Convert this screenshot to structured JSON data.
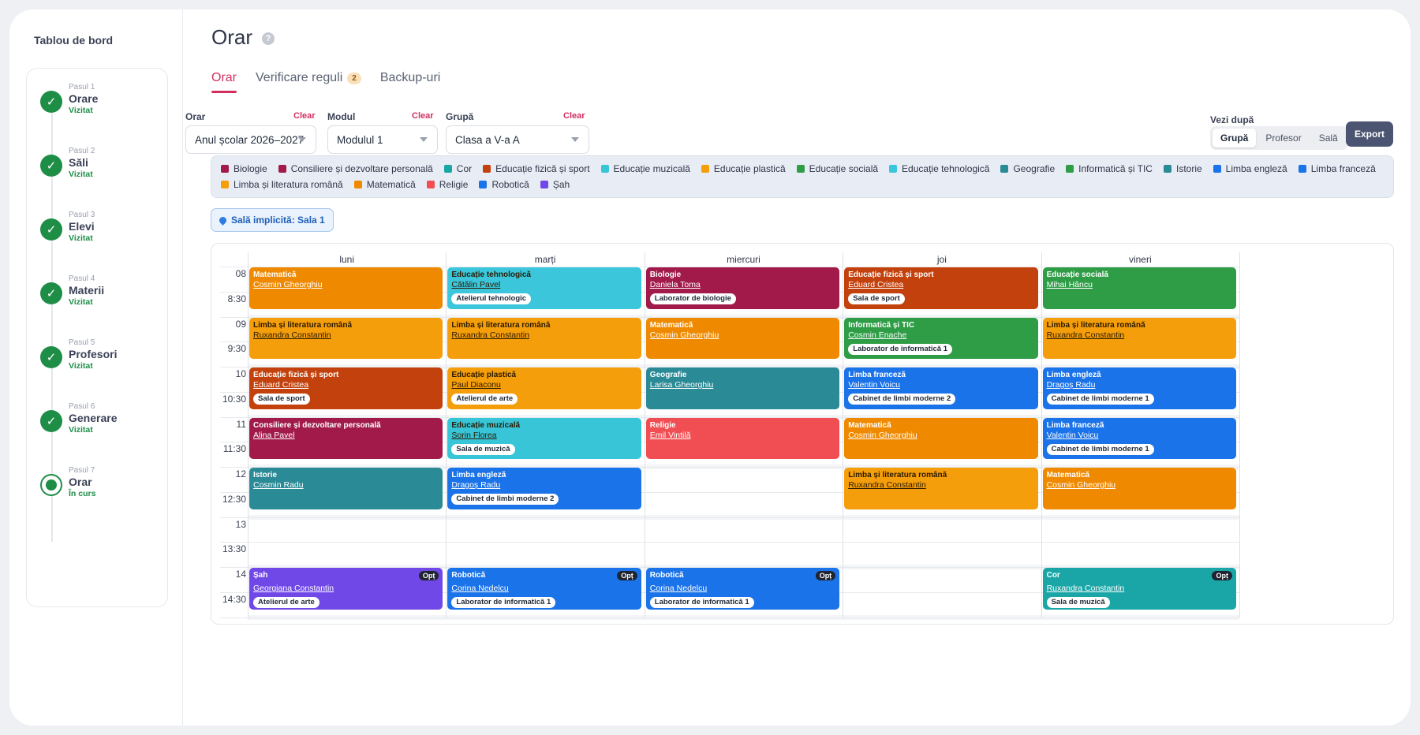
{
  "sidebar": {
    "title": "Tablou de bord",
    "steps": [
      {
        "num": "Pasul 1",
        "name": "Orare",
        "status": "Vizitat",
        "current": false
      },
      {
        "num": "Pasul 2",
        "name": "Săli",
        "status": "Vizitat",
        "current": false
      },
      {
        "num": "Pasul 3",
        "name": "Elevi",
        "status": "Vizitat",
        "current": false
      },
      {
        "num": "Pasul 4",
        "name": "Materii",
        "status": "Vizitat",
        "current": false
      },
      {
        "num": "Pasul 5",
        "name": "Profesori",
        "status": "Vizitat",
        "current": false
      },
      {
        "num": "Pasul 6",
        "name": "Generare",
        "status": "Vizitat",
        "current": false
      },
      {
        "num": "Pasul 7",
        "name": "Orar",
        "status": "În curs",
        "current": true
      }
    ]
  },
  "header": {
    "title": "Orar",
    "help_icon": "?",
    "tabs": [
      {
        "label": "Orar",
        "active": true
      },
      {
        "label": "Verificare reguli",
        "badge": "2",
        "active": false
      },
      {
        "label": "Backup-uri",
        "active": false
      }
    ]
  },
  "filters": {
    "orar": {
      "label": "Orar",
      "clear": "Clear",
      "value": "Anul școlar 2026–2027"
    },
    "modul": {
      "label": "Modul",
      "clear": "Clear",
      "value": "Modulul 1"
    },
    "grupa": {
      "label": "Grupă",
      "clear": "Clear",
      "value": "Clasa a V-a A"
    }
  },
  "view_by": {
    "label": "Vezi după",
    "options": [
      "Grupă",
      "Profesor",
      "Sală"
    ],
    "selected": "Grupă"
  },
  "export_label": "Export",
  "legend": [
    {
      "name": "Biologie",
      "color": "#a21a4a"
    },
    {
      "name": "Consiliere și dezvoltare personală",
      "color": "#a21a4a"
    },
    {
      "name": "Cor",
      "color": "#1aa6a6"
    },
    {
      "name": "Educație fizică și sport",
      "color": "#c2410c"
    },
    {
      "name": "Educație muzicală",
      "color": "#38c5d8"
    },
    {
      "name": "Educație plastică",
      "color": "#f59e0b"
    },
    {
      "name": "Educație socială",
      "color": "#2e9d46"
    },
    {
      "name": "Educație tehnologică",
      "color": "#3bc6dc"
    },
    {
      "name": "Geografie",
      "color": "#2a8a96"
    },
    {
      "name": "Informatică și TIC",
      "color": "#2e9d46"
    },
    {
      "name": "Istorie",
      "color": "#2a8a96"
    },
    {
      "name": "Limba engleză",
      "color": "#1a73e8"
    },
    {
      "name": "Limba franceză",
      "color": "#1a73e8"
    },
    {
      "name": "Limba și literatura română",
      "color": "#f59e0b"
    },
    {
      "name": "Matematică",
      "color": "#ef8a00"
    },
    {
      "name": "Religie",
      "color": "#f04e53"
    },
    {
      "name": "Robotică",
      "color": "#1a73e8"
    },
    {
      "name": "Șah",
      "color": "#7048e8"
    }
  ],
  "default_room": "Sală implicită: Sala 1",
  "timetable": {
    "days": [
      "luni",
      "marți",
      "miercuri",
      "joi",
      "vineri"
    ],
    "time_labels": [
      "08",
      "8:30",
      "09",
      "9:30",
      "10",
      "10:30",
      "11",
      "11:30",
      "12",
      "12:30",
      "13",
      "13:30",
      "14",
      "14:30"
    ],
    "opt_label": "Opț",
    "events": [
      {
        "day": 0,
        "start": 8.0,
        "end": 9.0,
        "subject": "Matematică",
        "teacher": "Cosmin Gheorghiu",
        "color": "#ef8a00"
      },
      {
        "day": 0,
        "start": 9.0,
        "end": 10.0,
        "subject": "Limba și literatura română",
        "teacher": "Ruxandra Constantin",
        "color": "#f59e0b",
        "dark": true
      },
      {
        "day": 0,
        "start": 10.0,
        "end": 11.0,
        "subject": "Educație fizică și sport",
        "teacher": "Eduard Cristea",
        "room": "Sala de sport",
        "color": "#c2410c"
      },
      {
        "day": 0,
        "start": 11.0,
        "end": 12.0,
        "subject": "Consiliere și dezvoltare personală",
        "teacher": "Alina Pavel",
        "color": "#a21a4a"
      },
      {
        "day": 0,
        "start": 12.0,
        "end": 13.0,
        "subject": "Istorie",
        "teacher": "Cosmin Radu",
        "color": "#2a8a96"
      },
      {
        "day": 0,
        "start": 14.0,
        "end": 15.0,
        "subject": "Șah",
        "teacher": "Georgiana Constantin",
        "room": "Atelierul de arte",
        "color": "#7048e8",
        "opt": true
      },
      {
        "day": 1,
        "start": 8.0,
        "end": 9.0,
        "subject": "Educație tehnologică",
        "teacher": "Cătălin Pavel",
        "room": "Atelierul tehnologic",
        "color": "#3bc6dc",
        "dark": true
      },
      {
        "day": 1,
        "start": 9.0,
        "end": 10.0,
        "subject": "Limba și literatura română",
        "teacher": "Ruxandra Constantin",
        "color": "#f59e0b",
        "dark": true
      },
      {
        "day": 1,
        "start": 10.0,
        "end": 11.0,
        "subject": "Educație plastică",
        "teacher": "Paul Diaconu",
        "room": "Atelierul de arte",
        "color": "#f59e0b",
        "dark": true
      },
      {
        "day": 1,
        "start": 11.0,
        "end": 12.0,
        "subject": "Educație muzicală",
        "teacher": "Sorin Florea",
        "room": "Sala de muzică",
        "color": "#38c5d8",
        "dark": true
      },
      {
        "day": 1,
        "start": 12.0,
        "end": 13.0,
        "subject": "Limba engleză",
        "teacher": "Dragoș Radu",
        "room": "Cabinet de limbi moderne 2",
        "color": "#1a73e8"
      },
      {
        "day": 1,
        "start": 14.0,
        "end": 15.0,
        "subject": "Robotică",
        "teacher": "Corina Nedelcu",
        "room": "Laborator de informatică 1",
        "color": "#1a73e8",
        "opt": true
      },
      {
        "day": 2,
        "start": 8.0,
        "end": 9.0,
        "subject": "Biologie",
        "teacher": "Daniela Toma",
        "room": "Laborator de biologie",
        "color": "#a21a4a"
      },
      {
        "day": 2,
        "start": 9.0,
        "end": 10.0,
        "subject": "Matematică",
        "teacher": "Cosmin Gheorghiu",
        "color": "#ef8a00"
      },
      {
        "day": 2,
        "start": 10.0,
        "end": 11.0,
        "subject": "Geografie",
        "teacher": "Larisa Gheorghiu",
        "color": "#2a8a96"
      },
      {
        "day": 2,
        "start": 11.0,
        "end": 12.0,
        "subject": "Religie",
        "teacher": "Emil Vintilă",
        "color": "#f04e53"
      },
      {
        "day": 2,
        "start": 14.0,
        "end": 15.0,
        "subject": "Robotică",
        "teacher": "Corina Nedelcu",
        "room": "Laborator de informatică 1",
        "color": "#1a73e8",
        "opt": true
      },
      {
        "day": 3,
        "start": 8.0,
        "end": 9.0,
        "subject": "Educație fizică și sport",
        "teacher": "Eduard Cristea",
        "room": "Sala de sport",
        "color": "#c2410c"
      },
      {
        "day": 3,
        "start": 9.0,
        "end": 10.0,
        "subject": "Informatică și TIC",
        "teacher": "Cosmin Enache",
        "room": "Laborator de informatică 1",
        "color": "#2e9d46"
      },
      {
        "day": 3,
        "start": 10.0,
        "end": 11.0,
        "subject": "Limba franceză",
        "teacher": "Valentin Voicu",
        "room": "Cabinet de limbi moderne 2",
        "color": "#1a73e8"
      },
      {
        "day": 3,
        "start": 11.0,
        "end": 12.0,
        "subject": "Matematică",
        "teacher": "Cosmin Gheorghiu",
        "color": "#ef8a00"
      },
      {
        "day": 3,
        "start": 12.0,
        "end": 13.0,
        "subject": "Limba și literatura română",
        "teacher": "Ruxandra Constantin",
        "color": "#f59e0b",
        "dark": true
      },
      {
        "day": 4,
        "start": 8.0,
        "end": 9.0,
        "subject": "Educație socială",
        "teacher": "Mihai Hâncu",
        "color": "#2e9d46"
      },
      {
        "day": 4,
        "start": 9.0,
        "end": 10.0,
        "subject": "Limba și literatura română",
        "teacher": "Ruxandra Constantin",
        "color": "#f59e0b",
        "dark": true
      },
      {
        "day": 4,
        "start": 10.0,
        "end": 11.0,
        "subject": "Limba engleză",
        "teacher": "Dragoș Radu",
        "room": "Cabinet de limbi moderne 1",
        "color": "#1a73e8"
      },
      {
        "day": 4,
        "start": 11.0,
        "end": 12.0,
        "subject": "Limba franceză",
        "teacher": "Valentin Voicu",
        "room": "Cabinet de limbi moderne 1",
        "color": "#1a73e8"
      },
      {
        "day": 4,
        "start": 12.0,
        "end": 13.0,
        "subject": "Matematică",
        "teacher": "Cosmin Gheorghiu",
        "color": "#ef8a00"
      },
      {
        "day": 4,
        "start": 14.0,
        "end": 15.0,
        "subject": "Cor",
        "teacher": "Ruxandra Constantin",
        "room": "Sala de muzică",
        "color": "#1aa6a6",
        "opt": true
      }
    ]
  }
}
